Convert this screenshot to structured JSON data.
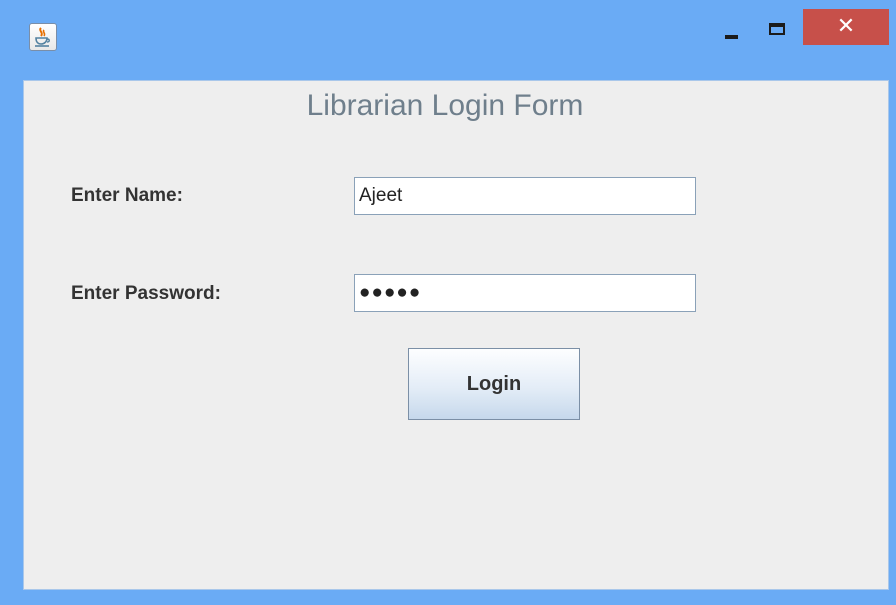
{
  "window": {
    "close_glyph": "✕"
  },
  "form": {
    "title": "Librarian Login Form",
    "name_label": "Enter Name:",
    "name_value": "Ajeet",
    "password_label": "Enter Password:",
    "password_value": "●●●●●",
    "login_label": "Login"
  },
  "colors": {
    "titlebar": "#6aabf5",
    "close_button": "#c7504a",
    "client_background": "#eeeeee"
  },
  "icons": {
    "app": "java-icon",
    "minimize": "minimize-icon",
    "maximize": "maximize-icon",
    "close": "close-icon"
  }
}
